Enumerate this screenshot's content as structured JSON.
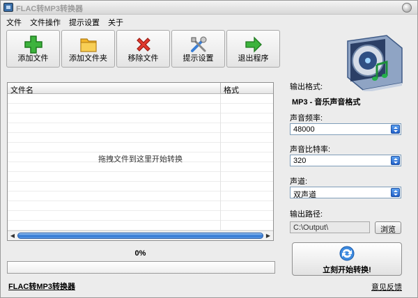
{
  "window": {
    "title": "FLAC转MP3转换器"
  },
  "menu": {
    "items": [
      "文件",
      "文件操作",
      "提示设置",
      "关于"
    ]
  },
  "toolbar": {
    "add_file": "添加文件",
    "add_folder": "添加文件夹",
    "remove_file": "移除文件",
    "settings": "提示设置",
    "exit": "退出程序"
  },
  "filelist": {
    "col_name": "文件名",
    "col_format": "格式",
    "hint": "拖拽文件到这里开始转换"
  },
  "progress": {
    "text": "0%",
    "value": 0
  },
  "footer": {
    "app_link": "FLAC转MP3转换器",
    "feedback": "意见反馈"
  },
  "settings": {
    "output_format_label": "输出格式:",
    "output_format_value": "MP3 - 音乐声音格式",
    "sample_rate_label": "声音频率:",
    "sample_rate_value": "48000",
    "bitrate_label": "声音比特率:",
    "bitrate_value": "320",
    "channel_label": "声道:",
    "channel_value": "双声道",
    "output_path_label": "输出路径:",
    "output_path_value": "C:\\Output\\",
    "browse": "浏览",
    "convert": "立刻开始转换!"
  }
}
